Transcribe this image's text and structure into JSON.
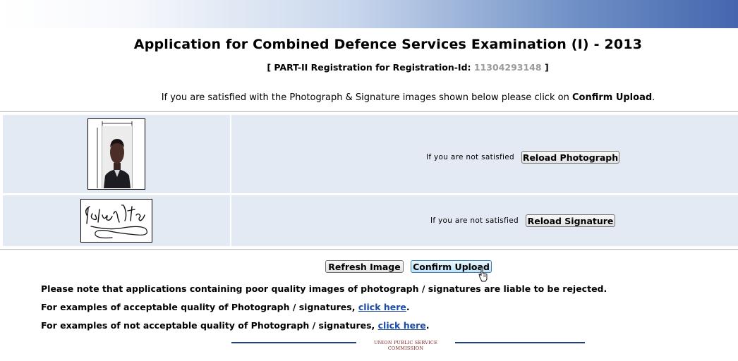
{
  "header": {
    "title": "Application for Combined Defence Services Examination (I) - 2013",
    "reg_prefix": "[ PART-II Registration for Registration-Id:",
    "reg_id": "11304293148",
    "reg_suffix": "]"
  },
  "instruction": {
    "text": "If you are satisfied with the Photograph & Signature images shown below please click on",
    "emphasis": "Confirm Upload",
    "end": "."
  },
  "photo_row": {
    "image_alt": "Applicant photograph",
    "not_satisfied": "If you are not satisfied",
    "reload_label": "Reload Photograph"
  },
  "signature_row": {
    "image_alt": "Applicant signature",
    "not_satisfied": "If you are not satisfied",
    "reload_label": "Reload Signature"
  },
  "actions": {
    "refresh_label": "Refresh Image",
    "confirm_label": "Confirm Upload"
  },
  "notes": {
    "warning": "Please note that applications containing poor quality images of photograph / signatures are liable to be rejected.",
    "acceptable_text": "For examples of acceptable quality of Photograph / signatures,",
    "acceptable_link": "click here",
    "not_acceptable_text": "For examples of not acceptable quality of Photograph / signatures,",
    "not_acceptable_link": "click here",
    "period": "."
  },
  "footer": {
    "text": "UNION PUBLIC SERVICE COMMISSION"
  },
  "colors": {
    "table_cell": "#e4eaf4",
    "link": "#1a4aa8",
    "reg_id": "#9a9a9a",
    "footer_line": "#1f3f84"
  }
}
